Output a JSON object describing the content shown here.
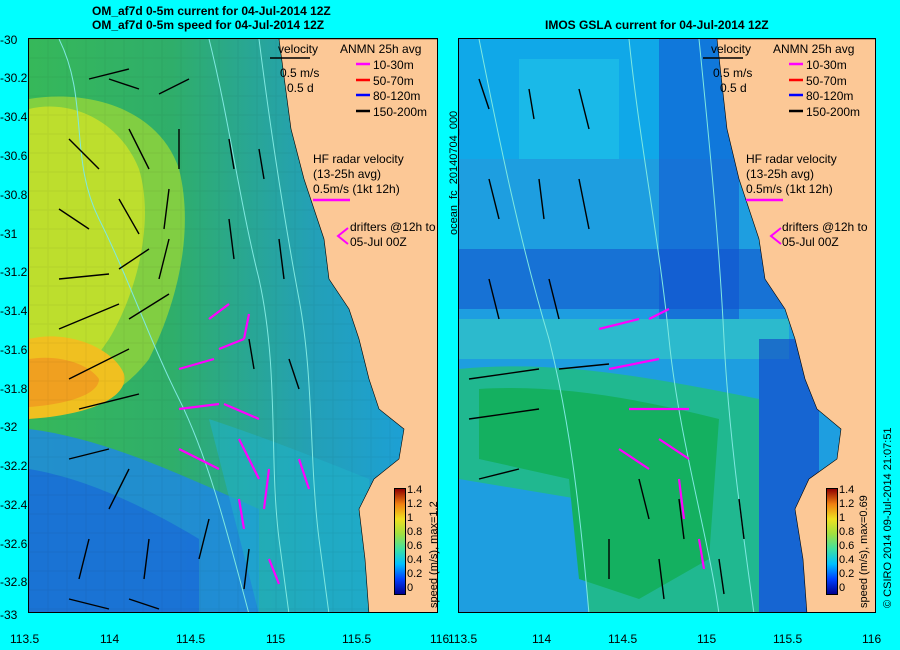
{
  "left": {
    "title1": "OM_af7d 0-5m current for 04-Jul-2014 12Z",
    "title2": "OM_af7d 0-5m speed for 04-Jul-2014 12Z",
    "colorbar_label": "speed (m/s), max=1.2",
    "legend": {
      "velocity": "velocity",
      "vscale1": "0.5 m/s",
      "vscale2": "0.5 d",
      "anmn": "ANMN 25h avg",
      "d1": "10-30m",
      "d2": "50-70m",
      "d3": "80-120m",
      "d4": "150-200m",
      "hf1": "HF radar velocity",
      "hf2": "(13-25h avg)",
      "hf3": "0.5m/s (1kt 12h)",
      "dr1": "drifters @12h to",
      "dr2": "05-Jul 00Z"
    }
  },
  "right": {
    "title1": "IMOS GSLA current for 04-Jul-2014 12Z",
    "colorbar_label": "speed (m/s), max=0.69",
    "side_label": "ocean_fc_20140704_000",
    "legend": {
      "velocity": "velocity",
      "vscale1": "0.5 m/s",
      "vscale2": "0.5 d",
      "anmn": "ANMN 25h avg",
      "d1": "10-30m",
      "d2": "50-70m",
      "d3": "80-120m",
      "d4": "150-200m",
      "hf1": "HF radar velocity",
      "hf2": "(13-25h avg)",
      "hf3": "0.5m/s (1kt 12h)",
      "dr1": "drifters @12h to",
      "dr2": "05-Jul 00Z"
    }
  },
  "credit": "© CSIRO 2014   09-Jul-2014 21:07:51",
  "colors": {
    "background": "#00ffff",
    "land": "#fcc896",
    "depth_10_30": "#ff00ff",
    "depth_50_70": "#ff0000",
    "depth_80_120": "#0000ff",
    "depth_150_200": "#000000"
  },
  "colorbar_ticks": [
    "1.4",
    "1.2",
    "1",
    "0.8",
    "0.6",
    "0.4",
    "0.2",
    "0"
  ],
  "y_ticks": [
    "-30",
    "-30.2",
    "-30.4",
    "-30.6",
    "-30.8",
    "-31",
    "-31.2",
    "-31.4",
    "-31.6",
    "-31.8",
    "-32",
    "-32.2",
    "-32.4",
    "-32.6",
    "-32.8",
    "-33"
  ],
  "x_ticks_left": [
    "113.5",
    "114",
    "114.5",
    "115",
    "115.5",
    "116"
  ],
  "x_ticks_right": [
    "113.5",
    "114",
    "114.5",
    "115",
    "115.5",
    "116"
  ]
}
